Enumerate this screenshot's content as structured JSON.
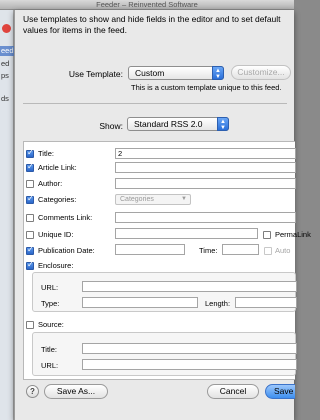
{
  "window": {
    "title": "Feeder – Reinvented Software"
  },
  "sidebar": {
    "items": [
      "eed",
      "ed",
      "ps",
      "ds"
    ]
  },
  "sheet": {
    "intro": "Use templates to show and hide fields in the editor and to set default values for items in the feed.",
    "template": {
      "label": "Use Template:",
      "value": "Custom",
      "customize_label": "Customize...",
      "note": "This is a custom template unique to this feed."
    },
    "show": {
      "label": "Show:",
      "value": "Standard RSS 2.0"
    },
    "fields": {
      "title": {
        "label": "Title:",
        "value": "2"
      },
      "article_link": {
        "label": "Article Link:"
      },
      "author": {
        "label": "Author:"
      },
      "categories": {
        "label": "Categories:",
        "popup": "Categories"
      },
      "comments_link": {
        "label": "Comments Link:"
      },
      "unique_id": {
        "label": "Unique ID:",
        "permalink": "PermaLink"
      },
      "publication_date": {
        "label": "Publication Date:",
        "time_label": "Time:",
        "auto": "Auto"
      },
      "enclosure": {
        "label": "Enclosure:",
        "url_label": "URL:",
        "type_label": "Type:",
        "length_label": "Length:"
      },
      "source": {
        "label": "Source:",
        "title_label": "Title:",
        "url_label": "URL:"
      }
    },
    "buttons": {
      "help": "?",
      "save_as": "Save As...",
      "cancel": "Cancel",
      "save": "Save"
    }
  }
}
